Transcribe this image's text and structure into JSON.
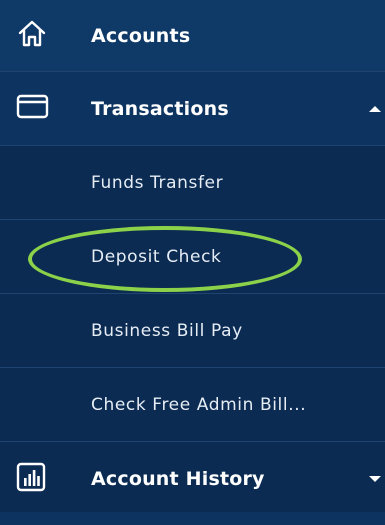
{
  "nav": {
    "accounts": {
      "label": "Accounts",
      "icon": "home-icon"
    },
    "transactions": {
      "label": "Transactions",
      "icon": "card-icon",
      "expanded": true,
      "items": [
        {
          "label": "Funds Transfer"
        },
        {
          "label": "Deposit Check",
          "highlighted": true
        },
        {
          "label": "Business Bill Pay"
        },
        {
          "label": "Check Free Admin Bill..."
        }
      ]
    },
    "account_history": {
      "label": "Account History",
      "icon": "bar-chart-icon",
      "expanded": false
    }
  },
  "colors": {
    "background": "#0b2b52",
    "header_background": "#0f3a68",
    "highlight_ring": "#8bd24a"
  }
}
